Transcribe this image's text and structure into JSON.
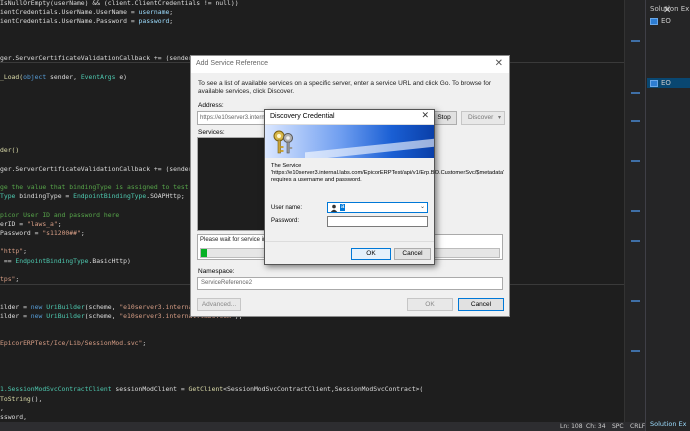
{
  "editor": {
    "lines": [
      {
        "segments": [
          {
            "t": "IsNullOrEmpty(userName) && (client.ClientCredentials != null))",
            "c": "plain"
          }
        ]
      },
      {
        "segments": [
          {
            "t": "ientCredentials.UserName.UserName = ",
            "c": "plain"
          },
          {
            "t": "username",
            "c": "id"
          },
          {
            "t": ";",
            "c": "plain"
          }
        ]
      },
      {
        "segments": [
          {
            "t": "ientCredentials.UserName.Password = ",
            "c": "plain"
          },
          {
            "t": "password",
            "c": "id"
          },
          {
            "t": ";",
            "c": "plain"
          }
        ]
      },
      {
        "segments": [
          {
            "t": "",
            "c": "plain"
          }
        ]
      },
      {
        "segments": [
          {
            "t": "",
            "c": "plain"
          }
        ]
      },
      {
        "segments": [
          {
            "t": "",
            "c": "plain"
          }
        ]
      },
      {
        "segments": [
          {
            "t": "ger.ServerCertificateValidationCallback += (sender, certi",
            "c": "plain"
          }
        ]
      },
      {
        "segments": [
          {
            "t": "",
            "c": "plain"
          }
        ]
      },
      {
        "segments": [
          {
            "t": "_Load(",
            "c": "fn"
          },
          {
            "t": "object",
            "c": "kw"
          },
          {
            "t": " sender, ",
            "c": "plain"
          },
          {
            "t": "EventArgs",
            "c": "type"
          },
          {
            "t": " e)",
            "c": "plain"
          }
        ]
      },
      {
        "segments": [
          {
            "t": "",
            "c": "plain"
          }
        ]
      },
      {
        "segments": [
          {
            "t": "",
            "c": "plain"
          }
        ]
      },
      {
        "segments": [
          {
            "t": "",
            "c": "plain"
          }
        ]
      },
      {
        "segments": [
          {
            "t": "",
            "c": "plain"
          }
        ]
      },
      {
        "segments": [
          {
            "t": "",
            "c": "plain"
          }
        ]
      },
      {
        "segments": [
          {
            "t": "",
            "c": "plain"
          }
        ]
      },
      {
        "segments": [
          {
            "t": "",
            "c": "plain"
          }
        ]
      },
      {
        "segments": [
          {
            "t": "der()",
            "c": "fn"
          }
        ]
      },
      {
        "segments": [
          {
            "t": "",
            "c": "plain"
          }
        ]
      },
      {
        "segments": [
          {
            "t": "ger.ServerCertificateValidationCallback += (sender, cert",
            "c": "plain"
          }
        ]
      },
      {
        "segments": [
          {
            "t": "",
            "c": "plain"
          }
        ]
      },
      {
        "segments": [
          {
            "t": "ge the value that bindingType is assigned to test either",
            "c": "com"
          }
        ]
      },
      {
        "segments": [
          {
            "t": "Type",
            "c": "type"
          },
          {
            "t": " bindingType = ",
            "c": "plain"
          },
          {
            "t": "EndpointBindingType",
            "c": "type"
          },
          {
            "t": ".SOAPHttp;",
            "c": "plain"
          }
        ]
      },
      {
        "segments": [
          {
            "t": "",
            "c": "plain"
          }
        ]
      },
      {
        "segments": [
          {
            "t": "picor User ID and password here",
            "c": "com"
          }
        ]
      },
      {
        "segments": [
          {
            "t": "erID = ",
            "c": "plain"
          },
          {
            "t": "\"laws_a\"",
            "c": "str"
          },
          {
            "t": ";",
            "c": "plain"
          }
        ]
      },
      {
        "segments": [
          {
            "t": "Password = ",
            "c": "plain"
          },
          {
            "t": "\"s11200##\"",
            "c": "str"
          },
          {
            "t": ";",
            "c": "plain"
          }
        ]
      },
      {
        "segments": [
          {
            "t": "",
            "c": "plain"
          }
        ]
      },
      {
        "segments": [
          {
            "t": "\"http\"",
            "c": "str"
          },
          {
            "t": ";",
            "c": "plain"
          }
        ]
      },
      {
        "segments": [
          {
            "t": " == ",
            "c": "plain"
          },
          {
            "t": "EndpointBindingType",
            "c": "type"
          },
          {
            "t": ".BasicHttp)",
            "c": "plain"
          }
        ]
      },
      {
        "segments": [
          {
            "t": "",
            "c": "plain"
          }
        ]
      },
      {
        "segments": [
          {
            "t": "tps\"",
            "c": "str"
          },
          {
            "t": ";",
            "c": "plain"
          }
        ]
      },
      {
        "segments": [
          {
            "t": "",
            "c": "plain"
          }
        ]
      },
      {
        "segments": [
          {
            "t": "",
            "c": "plain"
          }
        ]
      },
      {
        "segments": [
          {
            "t": "ilder = ",
            "c": "plain"
          },
          {
            "t": "new",
            "c": "kw"
          },
          {
            "t": " ",
            "c": "plain"
          },
          {
            "t": "UriBuilder",
            "c": "type"
          },
          {
            "t": "(scheme, ",
            "c": "plain"
          },
          {
            "t": "\"e10server3.internal.lab",
            "c": "str"
          }
        ]
      },
      {
        "segments": [
          {
            "t": "ilder = ",
            "c": "plain"
          },
          {
            "t": "new",
            "c": "kw"
          },
          {
            "t": " ",
            "c": "plain"
          },
          {
            "t": "UriBuilder",
            "c": "type"
          },
          {
            "t": "(scheme, ",
            "c": "plain"
          },
          {
            "t": "\"e10server3.internal.labs.com\"",
            "c": "str"
          },
          {
            "t": ");",
            "c": "plain"
          }
        ]
      },
      {
        "segments": [
          {
            "t": "",
            "c": "plain"
          }
        ]
      },
      {
        "segments": [
          {
            "t": "",
            "c": "plain"
          }
        ]
      },
      {
        "segments": [
          {
            "t": "EpicorERPTest/Ice/Lib/SessionMod.svc\"",
            "c": "str"
          },
          {
            "t": ";",
            "c": "plain"
          }
        ]
      },
      {
        "segments": [
          {
            "t": "",
            "c": "plain"
          }
        ]
      },
      {
        "segments": [
          {
            "t": "",
            "c": "plain"
          }
        ]
      },
      {
        "segments": [
          {
            "t": "",
            "c": "plain"
          }
        ]
      },
      {
        "segments": [
          {
            "t": "",
            "c": "plain"
          }
        ]
      },
      {
        "segments": [
          {
            "t": "1.SessionModSvcContractClient",
            "c": "type"
          },
          {
            "t": " sessionModClient = ",
            "c": "plain"
          },
          {
            "t": "GetClient",
            "c": "fn"
          },
          {
            "t": "<SessionModSvcContractClient,SessionModSvcContract>(",
            "c": "plain"
          }
        ]
      },
      {
        "segments": [
          {
            "t": "ToString",
            "c": "fn"
          },
          {
            "t": "(),",
            "c": "plain"
          }
        ]
      },
      {
        "segments": [
          {
            "t": ",",
            "c": "plain"
          }
        ]
      },
      {
        "segments": [
          {
            "t": "ssword,",
            "c": "plain"
          }
        ]
      },
      {
        "segments": [
          {
            "t": "",
            "c": "plain"
          }
        ]
      }
    ]
  },
  "status_bar": {
    "line": "Ln: 108",
    "col": "Ch: 34",
    "mode": "SPC",
    "eol": "CRLF"
  },
  "solution_panel": {
    "items": [
      "Solution Ex",
      "EO",
      "EO",
      "",
      "",
      "",
      "",
      "",
      "",
      "",
      "",
      "",
      "",
      "",
      "",
      "",
      "",
      "",
      "",
      "",
      "",
      "",
      "",
      "",
      "",
      "",
      ""
    ],
    "tab": "Solution Ex"
  },
  "add_service_reference": {
    "title": "Add Service Reference",
    "instructions": "To see a list of available services on a specific server, enter a service URL and click Go. To browse for available services, click Discover.",
    "address_label": "Address:",
    "address_value": "https://e10server3.internal.labs.com/EpicorERPTest/api/v1/Erp.BO.CustomerSvc/$metadata",
    "stop_label": "Stop",
    "discover_label": "Discover",
    "services_label": "Services:",
    "wait_text": "Please wait for service information to be downloaded or click Stop...",
    "progress": 0.02,
    "namespace_label": "Namespace:",
    "namespace_value": "ServiceReference2",
    "advanced_label": "Advanced...",
    "ok_label": "OK",
    "cancel_label": "Cancel"
  },
  "discovery_credential": {
    "title": "Discovery Credential",
    "message": "The Service 'https://e10server3.internal.labs.com/EpicorERPTest/api/v1/Erp.BO.CustomerSvc/$metadata' requires a username and password.",
    "username_label": "User name:",
    "username_value": "a",
    "password_label": "Password:",
    "ok_label": "OK",
    "cancel_label": "Cancel"
  },
  "colors": {
    "editor_bg": "#1e1e1e",
    "accent": "#0078d7",
    "progress": "#06b025",
    "keyword": "#569cd6",
    "type": "#4ec9b0",
    "string": "#d69d85",
    "comment": "#57a64a"
  }
}
